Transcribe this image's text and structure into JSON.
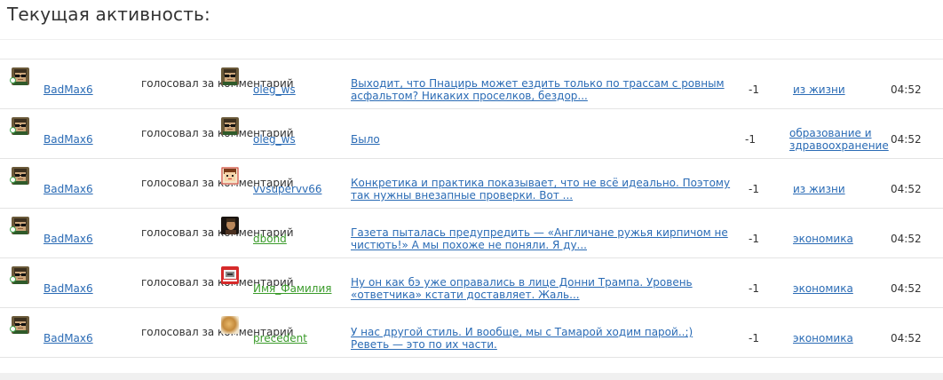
{
  "page": {
    "title": "Текущая активность:"
  },
  "feed": [
    {
      "voter": "BadMax6",
      "action": "голосовал за комментарий",
      "author": "oleg_ws",
      "author_green": false,
      "comment": "Выходит, что Пнацирь может ездить только по трассам с ровным асфальтом? Никаких проселков, бездор...",
      "score": "-1",
      "category": "из жизни",
      "time": "04:52",
      "avatar": "glasses"
    },
    {
      "voter": "BadMax6",
      "action": "голосовал за комментарий",
      "author": "oleg_ws",
      "author_green": false,
      "comment": "Было",
      "score": "-1",
      "category": "образование и здравоохранение",
      "time": "04:52",
      "avatar": "glasses"
    },
    {
      "voter": "BadMax6",
      "action": "голосовал за комментарий",
      "author": "vvsupervv66",
      "author_green": false,
      "comment": "Конкретика и практика показывает, что не всё идеально. Поэтому так нужны внезапные проверки. Вот ...",
      "score": "-1",
      "category": "из жизни",
      "time": "04:52",
      "avatar": "cartoon"
    },
    {
      "voter": "BadMax6",
      "action": "голосовал за комментарий",
      "author": "dbond",
      "author_green": true,
      "comment": "Газета пыталась предупредить — «Англичане ружья кирпичом не чистють!» А мы похоже не поняли. Я ду...",
      "score": "-1",
      "category": "экономика",
      "time": "04:52",
      "avatar": "portrait"
    },
    {
      "voter": "BadMax6",
      "action": "голосовал за комментарий",
      "author": "Имя_Фамилия",
      "author_green": true,
      "comment": "Ну он  как бэ уже оправались в лице Донни  Трампа.  Уровень «ответчика» кстати  доставляет.  Жаль...",
      "score": "-1",
      "category": "экономика",
      "time": "04:52",
      "avatar": "red"
    },
    {
      "voter": "BadMax6",
      "action": "голосовал за комментарий",
      "author": "precedent",
      "author_green": true,
      "comment": "У нас другой стиль.  И вообще, мы с Тамарой ходим парой..;) Реветь — это по их части.",
      "score": "-1",
      "category": "экономика",
      "time": "04:52",
      "avatar": "blur"
    }
  ]
}
